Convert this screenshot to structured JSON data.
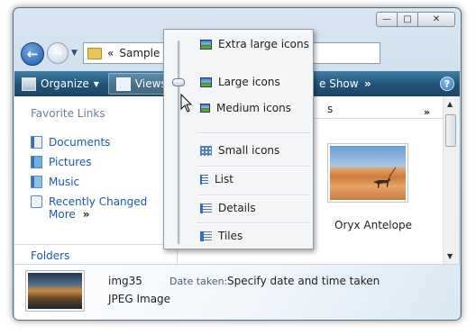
{
  "address": {
    "chevron": "«",
    "text": "Sample P"
  },
  "toolbar": {
    "organize": "Organize",
    "views": "Views",
    "slideshow": "e Show",
    "more": "»",
    "help": "?"
  },
  "nav": {
    "heading": "Favorite Links",
    "links": [
      {
        "label": "Documents",
        "icon": "documents-icon"
      },
      {
        "label": "Pictures",
        "icon": "pictures-icon"
      },
      {
        "label": "Music",
        "icon": "music-icon"
      },
      {
        "label": "Recently Changed",
        "icon": "recent-icon"
      }
    ],
    "more": "More",
    "more_arrows": "»",
    "folders": "Folders"
  },
  "content": {
    "column_partial": "s",
    "column_more": "»",
    "item_label": "Oryx Antelope"
  },
  "menu": {
    "items": [
      "Extra large icons",
      "Large icons",
      "Medium icons",
      "Small icons",
      "List",
      "Details",
      "Tiles"
    ]
  },
  "details": {
    "name": "img35",
    "type": "JPEG Image",
    "date_label": "Date taken:",
    "date_value": "Specify date and time taken"
  },
  "colors": {
    "toolbar": "#22557a",
    "link": "#1e57a8"
  }
}
